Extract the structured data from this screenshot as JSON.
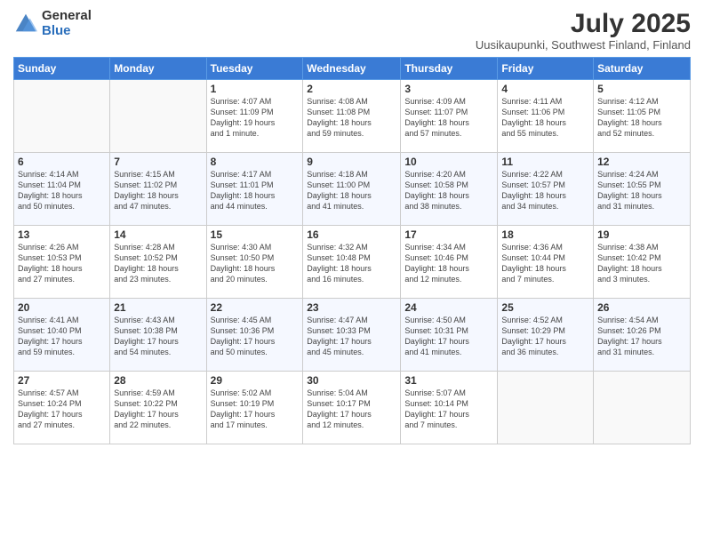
{
  "logo": {
    "general": "General",
    "blue": "Blue"
  },
  "header": {
    "month_year": "July 2025",
    "location": "Uusikaupunki, Southwest Finland, Finland"
  },
  "weekdays": [
    "Sunday",
    "Monday",
    "Tuesday",
    "Wednesday",
    "Thursday",
    "Friday",
    "Saturday"
  ],
  "weeks": [
    [
      {
        "day": "",
        "info": ""
      },
      {
        "day": "",
        "info": ""
      },
      {
        "day": "1",
        "info": "Sunrise: 4:07 AM\nSunset: 11:09 PM\nDaylight: 19 hours\nand 1 minute."
      },
      {
        "day": "2",
        "info": "Sunrise: 4:08 AM\nSunset: 11:08 PM\nDaylight: 18 hours\nand 59 minutes."
      },
      {
        "day": "3",
        "info": "Sunrise: 4:09 AM\nSunset: 11:07 PM\nDaylight: 18 hours\nand 57 minutes."
      },
      {
        "day": "4",
        "info": "Sunrise: 4:11 AM\nSunset: 11:06 PM\nDaylight: 18 hours\nand 55 minutes."
      },
      {
        "day": "5",
        "info": "Sunrise: 4:12 AM\nSunset: 11:05 PM\nDaylight: 18 hours\nand 52 minutes."
      }
    ],
    [
      {
        "day": "6",
        "info": "Sunrise: 4:14 AM\nSunset: 11:04 PM\nDaylight: 18 hours\nand 50 minutes."
      },
      {
        "day": "7",
        "info": "Sunrise: 4:15 AM\nSunset: 11:02 PM\nDaylight: 18 hours\nand 47 minutes."
      },
      {
        "day": "8",
        "info": "Sunrise: 4:17 AM\nSunset: 11:01 PM\nDaylight: 18 hours\nand 44 minutes."
      },
      {
        "day": "9",
        "info": "Sunrise: 4:18 AM\nSunset: 11:00 PM\nDaylight: 18 hours\nand 41 minutes."
      },
      {
        "day": "10",
        "info": "Sunrise: 4:20 AM\nSunset: 10:58 PM\nDaylight: 18 hours\nand 38 minutes."
      },
      {
        "day": "11",
        "info": "Sunrise: 4:22 AM\nSunset: 10:57 PM\nDaylight: 18 hours\nand 34 minutes."
      },
      {
        "day": "12",
        "info": "Sunrise: 4:24 AM\nSunset: 10:55 PM\nDaylight: 18 hours\nand 31 minutes."
      }
    ],
    [
      {
        "day": "13",
        "info": "Sunrise: 4:26 AM\nSunset: 10:53 PM\nDaylight: 18 hours\nand 27 minutes."
      },
      {
        "day": "14",
        "info": "Sunrise: 4:28 AM\nSunset: 10:52 PM\nDaylight: 18 hours\nand 23 minutes."
      },
      {
        "day": "15",
        "info": "Sunrise: 4:30 AM\nSunset: 10:50 PM\nDaylight: 18 hours\nand 20 minutes."
      },
      {
        "day": "16",
        "info": "Sunrise: 4:32 AM\nSunset: 10:48 PM\nDaylight: 18 hours\nand 16 minutes."
      },
      {
        "day": "17",
        "info": "Sunrise: 4:34 AM\nSunset: 10:46 PM\nDaylight: 18 hours\nand 12 minutes."
      },
      {
        "day": "18",
        "info": "Sunrise: 4:36 AM\nSunset: 10:44 PM\nDaylight: 18 hours\nand 7 minutes."
      },
      {
        "day": "19",
        "info": "Sunrise: 4:38 AM\nSunset: 10:42 PM\nDaylight: 18 hours\nand 3 minutes."
      }
    ],
    [
      {
        "day": "20",
        "info": "Sunrise: 4:41 AM\nSunset: 10:40 PM\nDaylight: 17 hours\nand 59 minutes."
      },
      {
        "day": "21",
        "info": "Sunrise: 4:43 AM\nSunset: 10:38 PM\nDaylight: 17 hours\nand 54 minutes."
      },
      {
        "day": "22",
        "info": "Sunrise: 4:45 AM\nSunset: 10:36 PM\nDaylight: 17 hours\nand 50 minutes."
      },
      {
        "day": "23",
        "info": "Sunrise: 4:47 AM\nSunset: 10:33 PM\nDaylight: 17 hours\nand 45 minutes."
      },
      {
        "day": "24",
        "info": "Sunrise: 4:50 AM\nSunset: 10:31 PM\nDaylight: 17 hours\nand 41 minutes."
      },
      {
        "day": "25",
        "info": "Sunrise: 4:52 AM\nSunset: 10:29 PM\nDaylight: 17 hours\nand 36 minutes."
      },
      {
        "day": "26",
        "info": "Sunrise: 4:54 AM\nSunset: 10:26 PM\nDaylight: 17 hours\nand 31 minutes."
      }
    ],
    [
      {
        "day": "27",
        "info": "Sunrise: 4:57 AM\nSunset: 10:24 PM\nDaylight: 17 hours\nand 27 minutes."
      },
      {
        "day": "28",
        "info": "Sunrise: 4:59 AM\nSunset: 10:22 PM\nDaylight: 17 hours\nand 22 minutes."
      },
      {
        "day": "29",
        "info": "Sunrise: 5:02 AM\nSunset: 10:19 PM\nDaylight: 17 hours\nand 17 minutes."
      },
      {
        "day": "30",
        "info": "Sunrise: 5:04 AM\nSunset: 10:17 PM\nDaylight: 17 hours\nand 12 minutes."
      },
      {
        "day": "31",
        "info": "Sunrise: 5:07 AM\nSunset: 10:14 PM\nDaylight: 17 hours\nand 7 minutes."
      },
      {
        "day": "",
        "info": ""
      },
      {
        "day": "",
        "info": ""
      }
    ]
  ]
}
